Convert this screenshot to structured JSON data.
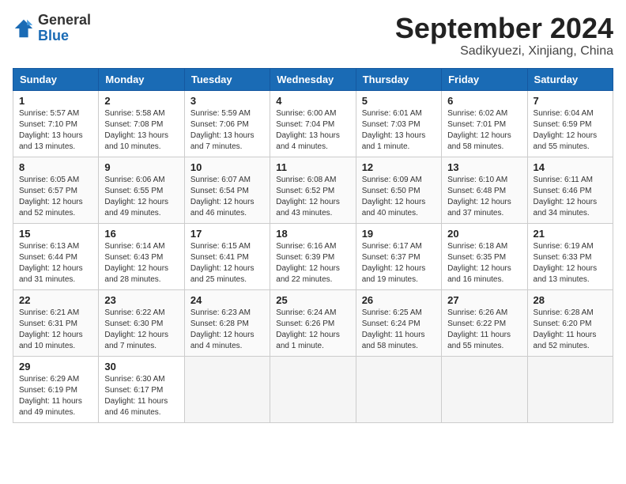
{
  "header": {
    "logo_general": "General",
    "logo_blue": "Blue",
    "title": "September 2024",
    "subtitle": "Sadikyuezi, Xinjiang, China"
  },
  "days_of_week": [
    "Sunday",
    "Monday",
    "Tuesday",
    "Wednesday",
    "Thursday",
    "Friday",
    "Saturday"
  ],
  "weeks": [
    [
      {
        "day": "1",
        "info": "Sunrise: 5:57 AM\nSunset: 7:10 PM\nDaylight: 13 hours\nand 13 minutes."
      },
      {
        "day": "2",
        "info": "Sunrise: 5:58 AM\nSunset: 7:08 PM\nDaylight: 13 hours\nand 10 minutes."
      },
      {
        "day": "3",
        "info": "Sunrise: 5:59 AM\nSunset: 7:06 PM\nDaylight: 13 hours\nand 7 minutes."
      },
      {
        "day": "4",
        "info": "Sunrise: 6:00 AM\nSunset: 7:04 PM\nDaylight: 13 hours\nand 4 minutes."
      },
      {
        "day": "5",
        "info": "Sunrise: 6:01 AM\nSunset: 7:03 PM\nDaylight: 13 hours\nand 1 minute."
      },
      {
        "day": "6",
        "info": "Sunrise: 6:02 AM\nSunset: 7:01 PM\nDaylight: 12 hours\nand 58 minutes."
      },
      {
        "day": "7",
        "info": "Sunrise: 6:04 AM\nSunset: 6:59 PM\nDaylight: 12 hours\nand 55 minutes."
      }
    ],
    [
      {
        "day": "8",
        "info": "Sunrise: 6:05 AM\nSunset: 6:57 PM\nDaylight: 12 hours\nand 52 minutes."
      },
      {
        "day": "9",
        "info": "Sunrise: 6:06 AM\nSunset: 6:55 PM\nDaylight: 12 hours\nand 49 minutes."
      },
      {
        "day": "10",
        "info": "Sunrise: 6:07 AM\nSunset: 6:54 PM\nDaylight: 12 hours\nand 46 minutes."
      },
      {
        "day": "11",
        "info": "Sunrise: 6:08 AM\nSunset: 6:52 PM\nDaylight: 12 hours\nand 43 minutes."
      },
      {
        "day": "12",
        "info": "Sunrise: 6:09 AM\nSunset: 6:50 PM\nDaylight: 12 hours\nand 40 minutes."
      },
      {
        "day": "13",
        "info": "Sunrise: 6:10 AM\nSunset: 6:48 PM\nDaylight: 12 hours\nand 37 minutes."
      },
      {
        "day": "14",
        "info": "Sunrise: 6:11 AM\nSunset: 6:46 PM\nDaylight: 12 hours\nand 34 minutes."
      }
    ],
    [
      {
        "day": "15",
        "info": "Sunrise: 6:13 AM\nSunset: 6:44 PM\nDaylight: 12 hours\nand 31 minutes."
      },
      {
        "day": "16",
        "info": "Sunrise: 6:14 AM\nSunset: 6:43 PM\nDaylight: 12 hours\nand 28 minutes."
      },
      {
        "day": "17",
        "info": "Sunrise: 6:15 AM\nSunset: 6:41 PM\nDaylight: 12 hours\nand 25 minutes."
      },
      {
        "day": "18",
        "info": "Sunrise: 6:16 AM\nSunset: 6:39 PM\nDaylight: 12 hours\nand 22 minutes."
      },
      {
        "day": "19",
        "info": "Sunrise: 6:17 AM\nSunset: 6:37 PM\nDaylight: 12 hours\nand 19 minutes."
      },
      {
        "day": "20",
        "info": "Sunrise: 6:18 AM\nSunset: 6:35 PM\nDaylight: 12 hours\nand 16 minutes."
      },
      {
        "day": "21",
        "info": "Sunrise: 6:19 AM\nSunset: 6:33 PM\nDaylight: 12 hours\nand 13 minutes."
      }
    ],
    [
      {
        "day": "22",
        "info": "Sunrise: 6:21 AM\nSunset: 6:31 PM\nDaylight: 12 hours\nand 10 minutes."
      },
      {
        "day": "23",
        "info": "Sunrise: 6:22 AM\nSunset: 6:30 PM\nDaylight: 12 hours\nand 7 minutes."
      },
      {
        "day": "24",
        "info": "Sunrise: 6:23 AM\nSunset: 6:28 PM\nDaylight: 12 hours\nand 4 minutes."
      },
      {
        "day": "25",
        "info": "Sunrise: 6:24 AM\nSunset: 6:26 PM\nDaylight: 12 hours\nand 1 minute."
      },
      {
        "day": "26",
        "info": "Sunrise: 6:25 AM\nSunset: 6:24 PM\nDaylight: 11 hours\nand 58 minutes."
      },
      {
        "day": "27",
        "info": "Sunrise: 6:26 AM\nSunset: 6:22 PM\nDaylight: 11 hours\nand 55 minutes."
      },
      {
        "day": "28",
        "info": "Sunrise: 6:28 AM\nSunset: 6:20 PM\nDaylight: 11 hours\nand 52 minutes."
      }
    ],
    [
      {
        "day": "29",
        "info": "Sunrise: 6:29 AM\nSunset: 6:19 PM\nDaylight: 11 hours\nand 49 minutes."
      },
      {
        "day": "30",
        "info": "Sunrise: 6:30 AM\nSunset: 6:17 PM\nDaylight: 11 hours\nand 46 minutes."
      },
      {
        "day": "",
        "info": ""
      },
      {
        "day": "",
        "info": ""
      },
      {
        "day": "",
        "info": ""
      },
      {
        "day": "",
        "info": ""
      },
      {
        "day": "",
        "info": ""
      }
    ]
  ]
}
